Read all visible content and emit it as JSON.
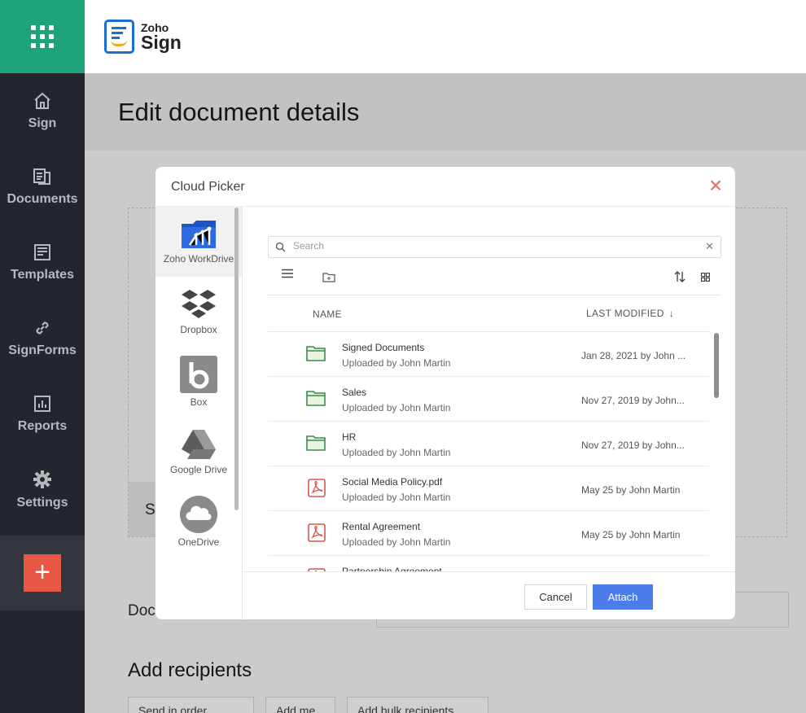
{
  "app": {
    "brand_top": "Zoho",
    "brand_bottom": "Sign"
  },
  "nav": {
    "items": [
      {
        "label": "Sign",
        "icon": "home-icon"
      },
      {
        "label": "Documents",
        "icon": "documents-icon"
      },
      {
        "label": "Templates",
        "icon": "templates-icon"
      },
      {
        "label": "SignForms",
        "icon": "link-icon"
      },
      {
        "label": "Reports",
        "icon": "reports-icon"
      },
      {
        "label": "Settings",
        "icon": "gear-icon"
      }
    ],
    "add_label": "+"
  },
  "page": {
    "title": "Edit document details",
    "drop_footer_text": "Se",
    "doc_label": "Doc",
    "add_recipients": "Add recipients",
    "recipient_buttons": [
      "Send in order",
      "Add me",
      "Add bulk recipients"
    ]
  },
  "modal": {
    "title": "Cloud Picker",
    "close_label": "×",
    "providers": [
      {
        "label": "Zoho WorkDrive",
        "icon": "workdrive-icon"
      },
      {
        "label": "Dropbox",
        "icon": "dropbox-icon"
      },
      {
        "label": "Box",
        "icon": "box-icon"
      },
      {
        "label": "Google Drive",
        "icon": "google-drive-icon"
      },
      {
        "label": "OneDrive",
        "icon": "onedrive-icon"
      }
    ],
    "search": {
      "placeholder": "Search",
      "value": ""
    },
    "columns": {
      "name": "NAME",
      "modified": "LAST MODIFIED"
    },
    "files": [
      {
        "type": "folder",
        "name": "Signed Documents",
        "uploader": "Uploaded by John Martin",
        "modified": "Jan 28, 2021 by John ..."
      },
      {
        "type": "folder",
        "name": "Sales",
        "uploader": "Uploaded by John Martin",
        "modified": "Nov 27, 2019 by John..."
      },
      {
        "type": "folder",
        "name": "HR",
        "uploader": "Uploaded by John Martin",
        "modified": "Nov 27, 2019 by John..."
      },
      {
        "type": "pdf",
        "name": "Social Media Policy.pdf",
        "uploader": "Uploaded by John Martin",
        "modified": "May 25 by John Martin"
      },
      {
        "type": "pdf",
        "name": "Rental Agreement",
        "uploader": "Uploaded by John Martin",
        "modified": "May 25 by John Martin"
      },
      {
        "type": "pdf",
        "name": "Partnership Agreement",
        "uploader": "",
        "modified": ""
      }
    ],
    "cancel_label": "Cancel",
    "attach_label": "Attach",
    "colors": {
      "accent": "#4c7bea",
      "close": "#e06e5f",
      "folder": "#3d8a4a",
      "pdf": "#d9534f"
    }
  }
}
